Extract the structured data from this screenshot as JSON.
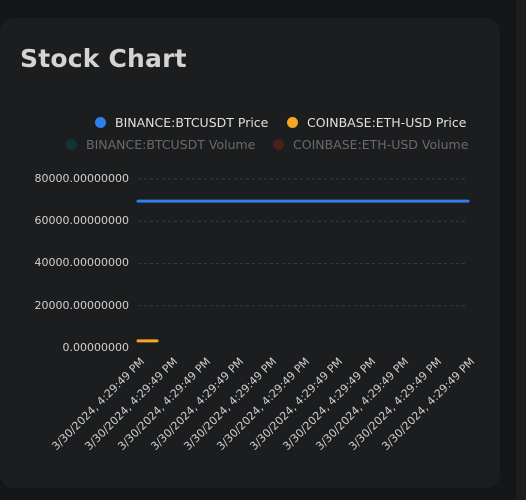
{
  "card": {
    "title": "Stock Chart"
  },
  "chart_data": {
    "type": "line",
    "legend_position": "top-right",
    "grid": true,
    "ylim": [
      0,
      80000
    ],
    "y_ticks": [
      "80000.00000000",
      "60000.00000000",
      "40000.00000000",
      "20000.00000000",
      "0.00000000"
    ],
    "x": [
      "3/30/2024, 4:29:49 PM",
      "3/30/2024, 4:29:49 PM",
      "3/30/2024, 4:29:49 PM",
      "3/30/2024, 4:29:49 PM",
      "3/30/2024, 4:29:49 PM",
      "3/30/2024, 4:29:49 PM",
      "3/30/2024, 4:29:49 PM",
      "3/30/2024, 4:29:49 PM",
      "3/30/2024, 4:29:49 PM",
      "3/30/2024, 4:29:49 PM",
      "3/30/2024, 4:29:49 PM"
    ],
    "series": [
      {
        "name": "BINANCE:BTCUSDT Price",
        "color": "#2f80ed",
        "visible": true,
        "values": [
          69500,
          69500,
          69500,
          69500,
          69500,
          69500,
          69500,
          69500,
          69500,
          69500,
          69500
        ]
      },
      {
        "name": "COINBASE:ETH-USD Price",
        "color": "#f5a623",
        "visible": true,
        "values": [
          3400,
          null,
          null,
          null,
          null,
          null,
          null,
          null,
          null,
          null,
          null
        ]
      },
      {
        "name": "BINANCE:BTCUSDT Volume",
        "color": "#11343a",
        "visible": false,
        "values": []
      },
      {
        "name": "COINBASE:ETH-USD Volume",
        "color": "#4a2019",
        "visible": false,
        "values": []
      }
    ]
  }
}
